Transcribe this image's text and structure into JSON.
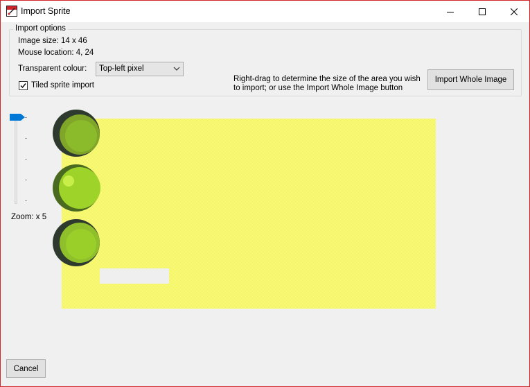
{
  "window": {
    "title": "Import Sprite",
    "accent_color": "#d0262a"
  },
  "import_options": {
    "legend": "Import options",
    "image_size_label": "Image size: 14 x 46",
    "mouse_location_label": "Mouse location: 4, 24",
    "transparent_colour_label": "Transparent colour:",
    "transparent_colour_value": "Top-left pixel",
    "tiled_import_label": "Tiled sprite import",
    "tiled_import_checked": true,
    "help_text": "Right-drag to determine the size of the area you wish to import; or use the Import Whole Image button",
    "import_whole_button": "Import Whole Image"
  },
  "zoom": {
    "label": "Zoom: x 5",
    "level": 5
  },
  "canvas": {
    "background_color": "#f7f76f",
    "sprite_colors": [
      "#7fa628",
      "#9ed42a",
      "#2f3a2e"
    ]
  },
  "footer": {
    "cancel_button": "Cancel"
  }
}
